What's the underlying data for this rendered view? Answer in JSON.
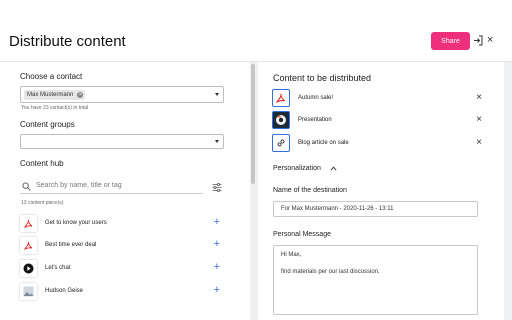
{
  "header": {
    "title": "Distribute content",
    "share_label": "Share",
    "close_glyph": "×",
    "exit_icon": "exit-icon"
  },
  "left": {
    "contact": {
      "label": "Choose a contact",
      "chip": "Max Mustermann",
      "count_text": "You have 23 contact(s) in total"
    },
    "groups": {
      "label": "Content groups",
      "value": ""
    },
    "hub": {
      "label": "Content hub",
      "search_placeholder": "Search by name, title or tag",
      "count_text": "13 content piece(s)",
      "items": [
        {
          "name": "Get to know your users",
          "icon": "pdf-icon"
        },
        {
          "name": "Best time ever deal",
          "icon": "pdf-icon"
        },
        {
          "name": "Let's chat",
          "icon": "video-icon"
        },
        {
          "name": "Hudson Geise",
          "icon": "image-icon"
        }
      ],
      "plus_glyph": "+"
    }
  },
  "right": {
    "heading": "Content to be distributed",
    "items": [
      {
        "name": "Autumn sale!",
        "icon": "pdf-icon"
      },
      {
        "name": "Presentation",
        "icon": "presentation-icon"
      },
      {
        "name": "Blog article on sale",
        "icon": "link-icon"
      }
    ],
    "remove_glyph": "×",
    "personalization_label": "Personalization",
    "destination": {
      "label": "Name of the destination",
      "value": "For Max Mustermann - 2020-11-26 - 13:11"
    },
    "message": {
      "label": "Personal Message",
      "line1": "Hi Max,",
      "line2": "find materials per our last discussion."
    }
  },
  "colors": {
    "accent": "#ee2f7c",
    "link": "#3d6fe0",
    "pdf_red": "#e0201b"
  }
}
